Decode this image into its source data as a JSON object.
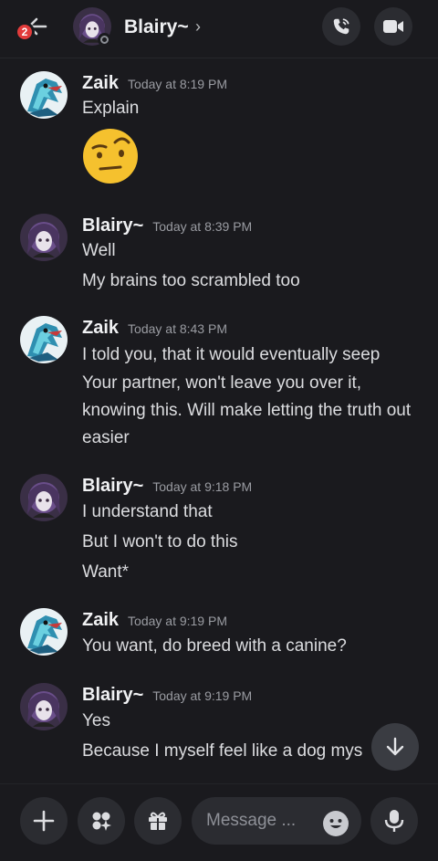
{
  "header": {
    "back_badge": "2",
    "title": "Blairy~",
    "chevron": "›",
    "call_icon": "phone-icon",
    "video_icon": "video-camera-icon"
  },
  "messages": [
    {
      "author": "Zaik",
      "time": "Today at 8:19 PM",
      "lines": [
        "Explain"
      ],
      "emoji": "raised-eyebrow-face"
    },
    {
      "author": "Blairy~",
      "time": "Today at 8:39 PM",
      "lines": [
        "Well",
        "My brains too scrambled too"
      ]
    },
    {
      "author": "Zaik",
      "time": "Today at 8:43 PM",
      "lines": [
        "I told you, that it would eventually seep",
        "Your partner, won't leave you over it, knowing this. Will make letting the truth out easier"
      ]
    },
    {
      "author": "Blairy~",
      "time": "Today at 9:18 PM",
      "lines": [
        "I understand that",
        "But I won't to do this",
        "Want*"
      ]
    },
    {
      "author": "Zaik",
      "time": "Today at 9:19 PM",
      "lines": [
        "You want, do breed with a canine?"
      ]
    },
    {
      "author": "Blairy~",
      "time": "Today at 9:19 PM",
      "lines": [
        "Yes",
        "Because I myself feel like a dog mys"
      ]
    }
  ],
  "composer": {
    "placeholder": "Message ...",
    "add_icon": "plus-icon",
    "apps_icon": "apps-icon",
    "gift_icon": "gift-icon",
    "emoji_icon": "emoji-icon",
    "mic_icon": "microphone-icon"
  },
  "colors": {
    "background": "#1a1a1e",
    "badge": "#e23b3b",
    "button": "#2b2c31"
  }
}
